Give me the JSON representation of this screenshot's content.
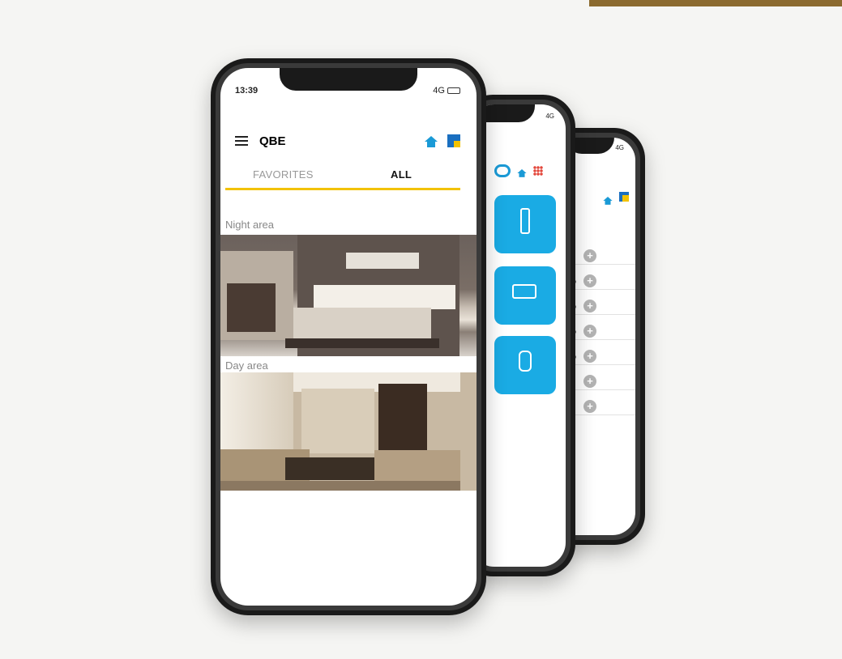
{
  "app": {
    "status_time": "13:39",
    "network": "4G",
    "title": "QBE",
    "tabs": [
      "FAVORITES",
      "ALL"
    ],
    "active_tab": "ALL",
    "areas": [
      "Night area",
      "Day area"
    ]
  },
  "second_screen": {
    "network": "4G",
    "tiles": [
      "tile-1",
      "tile-2",
      "tile-3"
    ]
  },
  "third_screen": {
    "network": "4G",
    "rows": [
      {
        "value": ""
      },
      {
        "value": "100%"
      },
      {
        "value": "100%"
      },
      {
        "value": "100%"
      },
      {
        "value": "100%"
      },
      {
        "value": ""
      },
      {
        "value": ""
      }
    ]
  },
  "colors": {
    "accent_blue": "#1aabe4",
    "tab_underline": "#f2c200",
    "brand_gold": "#8b6a2f"
  },
  "icons": [
    "menu-icon",
    "home-icon",
    "grid-icon",
    "refresh-icon",
    "dots-grid-icon",
    "plus-icon"
  ]
}
